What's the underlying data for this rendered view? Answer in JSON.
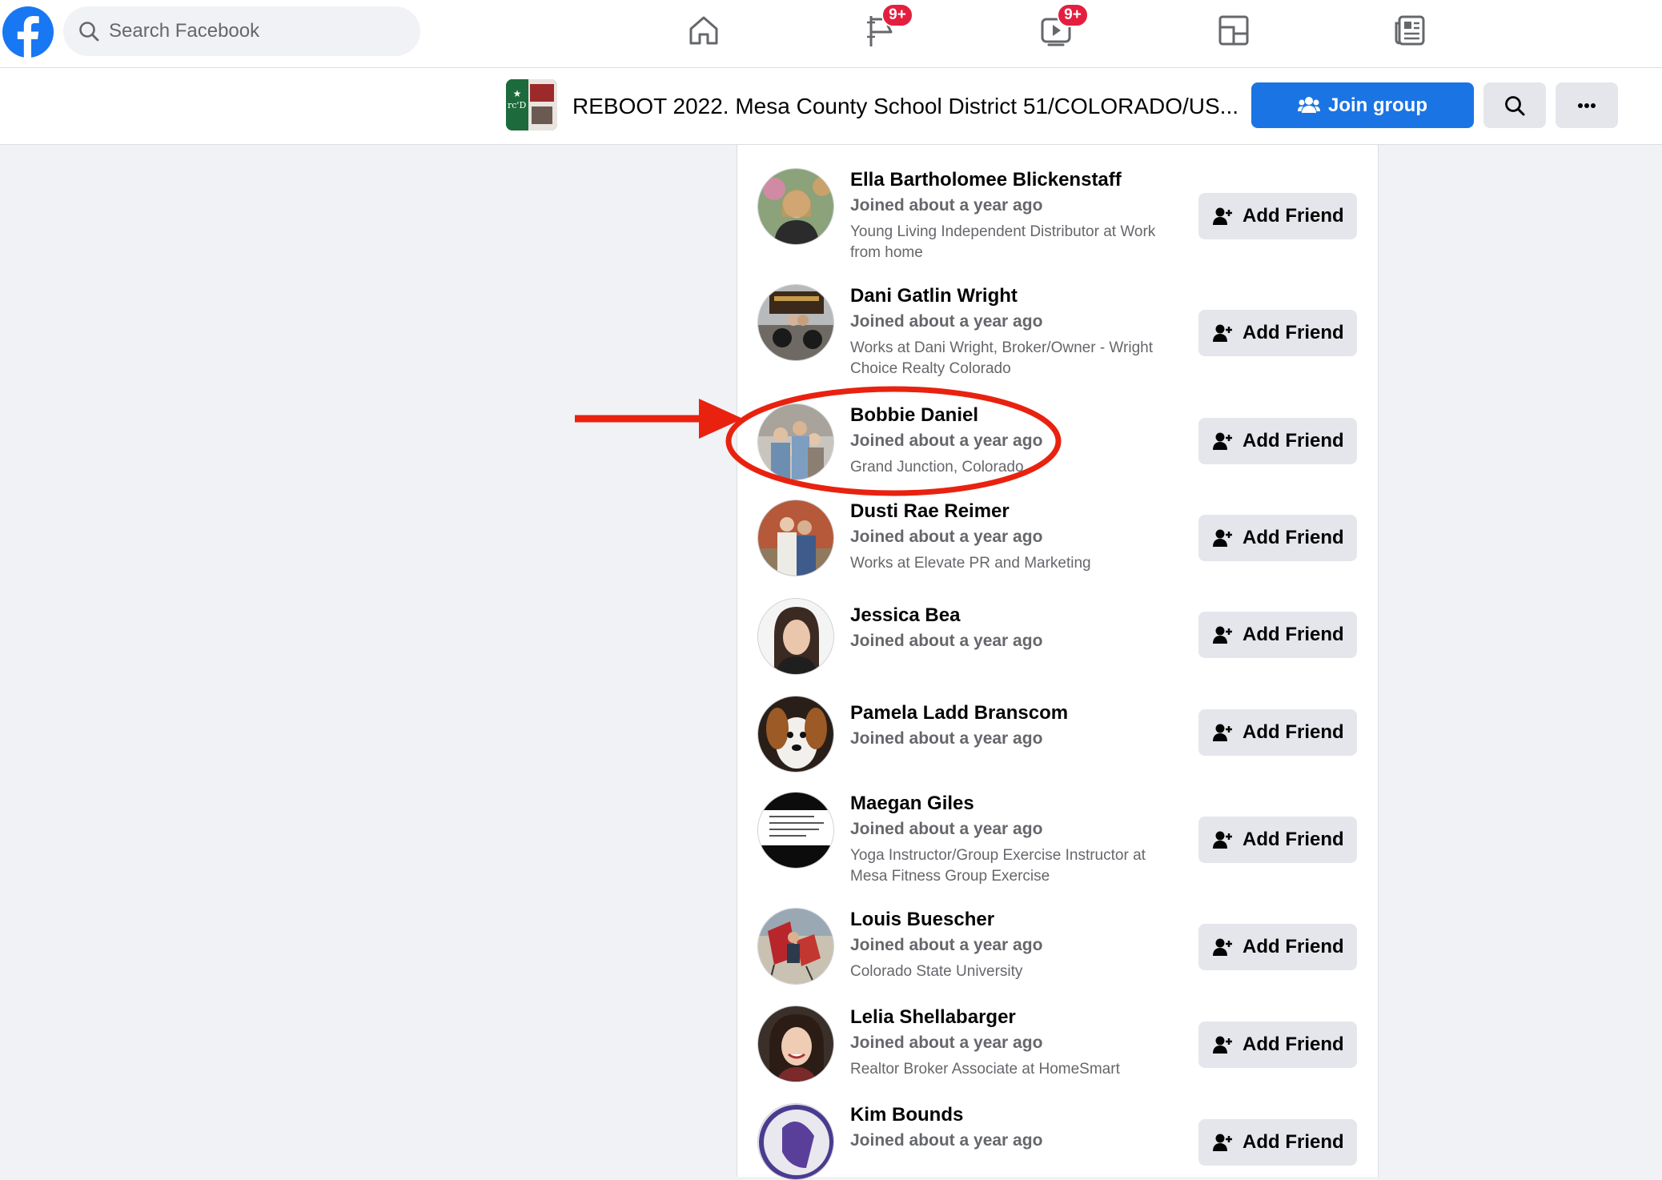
{
  "topnav": {
    "search_placeholder": "Search Facebook",
    "badges": {
      "pages": "9+",
      "watch": "9+"
    },
    "icons": [
      "facebook-logo",
      "search-icon",
      "home-icon",
      "pages-flag-icon",
      "watch-icon",
      "gaming-icon",
      "news-icon"
    ]
  },
  "group": {
    "title": "REBOOT 2022. Mesa County School District 51/COLORADO/US...",
    "join_label": "Join group",
    "accent_color": "#1b74e4"
  },
  "members": [
    {
      "name": "Ella Bartholomee Blickenstaff",
      "joined": "Joined about a year ago",
      "info": "Young Living Independent Distributor at Work from home",
      "action": "Add Friend"
    },
    {
      "name": "Dani Gatlin Wright",
      "joined": "Joined about a year ago",
      "info": "Works at Dani Wright, Broker/Owner - Wright Choice Realty Colorado",
      "action": "Add Friend"
    },
    {
      "name": "Bobbie Daniel",
      "joined": "Joined about a year ago",
      "info": "Grand Junction, Colorado",
      "action": "Add Friend"
    },
    {
      "name": "Dusti Rae Reimer",
      "joined": "Joined about a year ago",
      "info": "Works at Elevate PR and Marketing",
      "action": "Add Friend"
    },
    {
      "name": "Jessica Bea",
      "joined": "Joined about a year ago",
      "info": "",
      "action": "Add Friend"
    },
    {
      "name": "Pamela Ladd Branscom",
      "joined": "Joined about a year ago",
      "info": "",
      "action": "Add Friend"
    },
    {
      "name": "Maegan Giles",
      "joined": "Joined about a year ago",
      "info": "Yoga Instructor/Group Exercise Instructor at Mesa Fitness Group Exercise",
      "action": "Add Friend"
    },
    {
      "name": "Louis Buescher",
      "joined": "Joined about a year ago",
      "info": "Colorado State University",
      "action": "Add Friend"
    },
    {
      "name": "Lelia Shellabarger",
      "joined": "Joined about a year ago",
      "info": "Realtor Broker Associate at HomeSmart",
      "action": "Add Friend"
    },
    {
      "name": "Kim Bounds",
      "joined": "Joined about a year ago",
      "info": "",
      "action": "Add Friend"
    }
  ],
  "annotation": {
    "color": "#e8220f",
    "highlighted_member": "Bobbie Daniel"
  }
}
